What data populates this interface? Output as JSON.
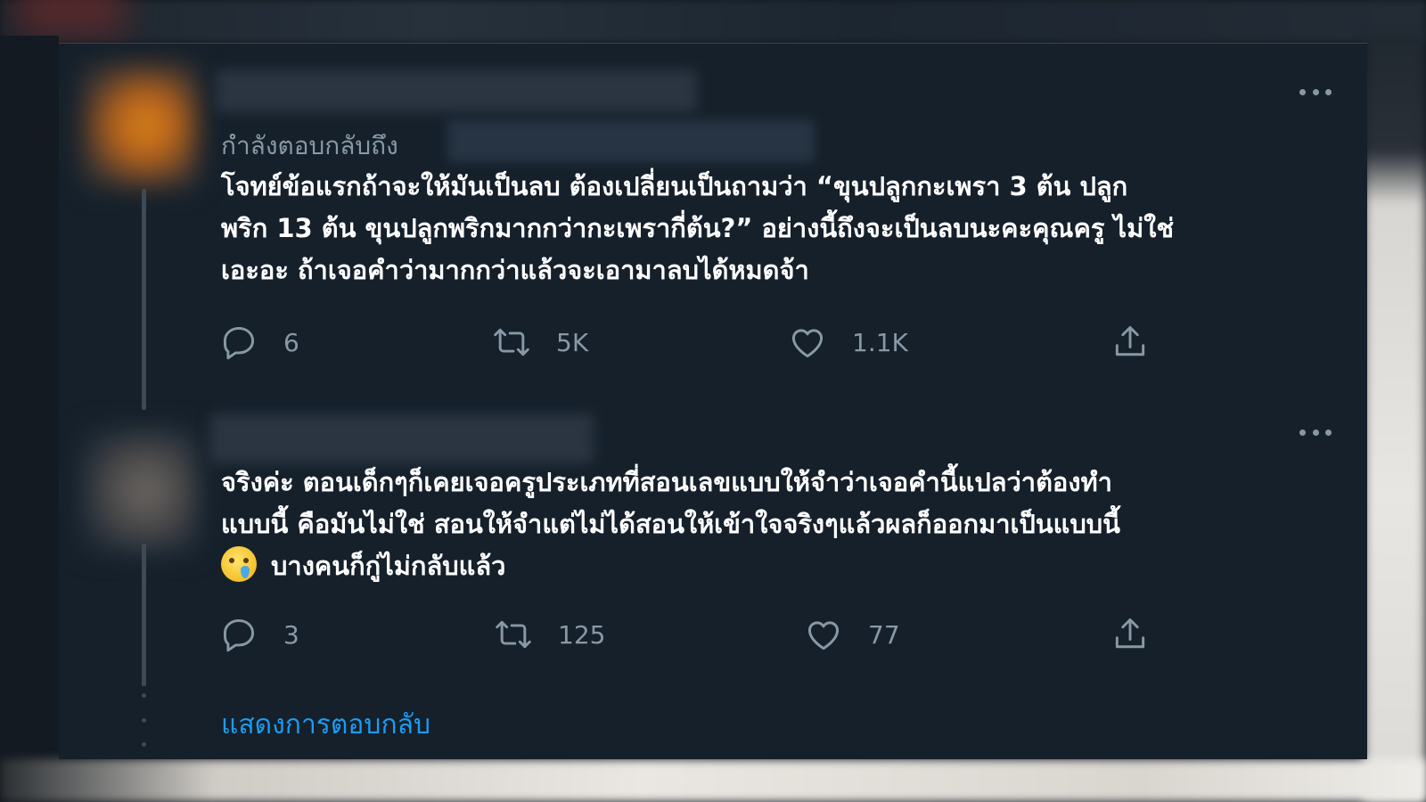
{
  "tweets": [
    {
      "replying_to_label": "กำลังตอบกลับถึง",
      "text_lines": [
        "โจทย์ข้อแรกถ้าจะให้มันเป็นลบ ต้องเปลี่ยนเป็นถามว่า “ขุนปลูกกะเพรา 3 ต้น ปลูก",
        "พริก 13 ต้น ขุนปลูกพริกมากกว่ากะเพรากี่ต้น?” อย่างนี้ถึงจะเป็นลบนะคะคุณครู ไม่ใช่",
        "เอะอะ ถ้าเจอคำว่ามากกว่าแล้วจะเอามาลบได้หมดจ้า"
      ],
      "counts": {
        "replies": "6",
        "retweets": "5K",
        "likes": "1.1K"
      }
    },
    {
      "text_lines": [
        "จริงค่ะ ตอนเด็กๆก็เคยเจอครูประเภทที่สอนเลขแบบให้จำว่าเจอคำนี้แปลว่าต้องทำ",
        "แบบนี้ คือมันไม่ใช่ สอนให้จำแต่ไม่ได้สอนให้เข้าใจจริงๆแล้วผลก็ออกมาเป็นแบบนี้",
        "บางคนก็กู่ไม่กลับแล้ว"
      ],
      "emoji": "smiling-face-with-tear",
      "counts": {
        "replies": "3",
        "retweets": "125",
        "likes": "77"
      }
    }
  ],
  "show_replies_label": "แสดงการตอบกลับ",
  "icons": {
    "reply": "reply-icon",
    "retweet": "retweet-icon",
    "like": "heart-icon",
    "share": "share-icon",
    "more": "more-icon"
  },
  "colors": {
    "background": "#15202b",
    "text": "#ffffff",
    "secondary": "#8899a6",
    "link": "#1d9bf0"
  }
}
